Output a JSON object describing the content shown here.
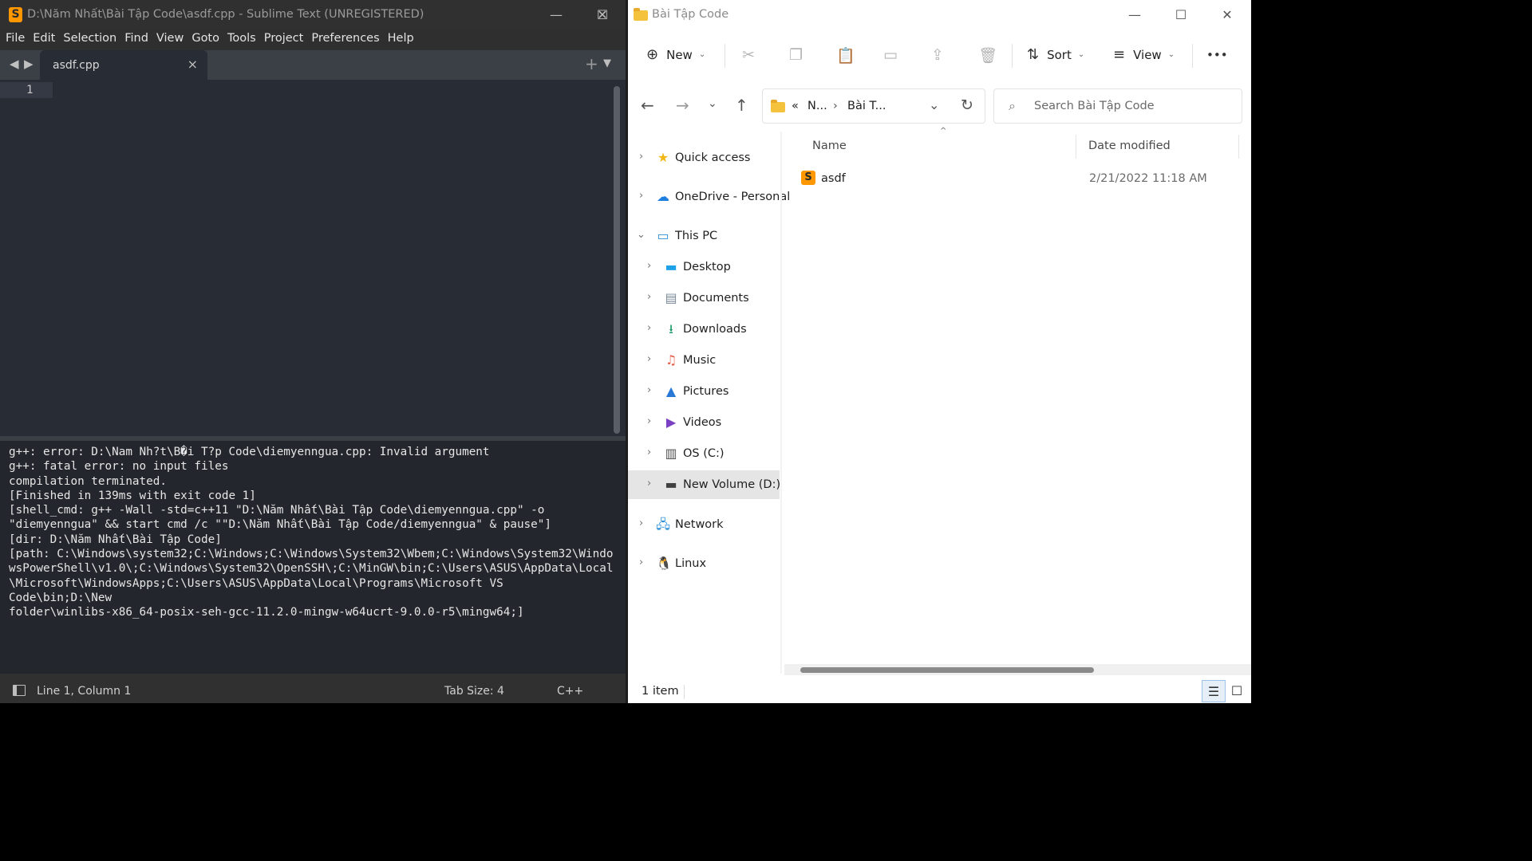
{
  "sublime": {
    "title": "D:\\Năm Nhất\\Bài Tập Code\\asdf.cpp - Sublime Text (UNREGISTERED)",
    "logo_glyph": "S",
    "window_controls": {
      "minimize": "—",
      "maximize": "☐",
      "close": "✕"
    },
    "menu": [
      "File",
      "Edit",
      "Selection",
      "Find",
      "View",
      "Goto",
      "Tools",
      "Project",
      "Preferences",
      "Help"
    ],
    "tab_nav": {
      "back": "◀",
      "forward": "▶"
    },
    "tab": {
      "label": "asdf.cpp",
      "close": "×"
    },
    "tab_actions": {
      "new_tab": "+",
      "tab_list": "▼"
    },
    "line_number": "1",
    "output": "g++: error: D:\\Nam Nh?t\\B�i T?p Code\\diemyenngua.cpp: Invalid argument\ng++: fatal error: no input files\ncompilation terminated.\n[Finished in 139ms with exit code 1]\n[shell_cmd: g++ -Wall -std=c++11 \"D:\\Năm Nhất\\Bài Tập Code\\diemyenngua.cpp\" -o\n\"diemyenngua\" && start cmd /c \"\"D:\\Năm Nhất\\Bài Tập Code/diemyenngua\" & pause\"]\n[dir: D:\\Năm Nhất\\Bài Tập Code]\n[path: C:\\Windows\\system32;C:\\Windows;C:\\Windows\\System32\\Wbem;C:\\Windows\\System32\\Windo\nwsPowerShell\\v1.0\\;C:\\Windows\\System32\\OpenSSH\\;C:\\MinGW\\bin;C:\\Users\\ASUS\\AppData\\Local\n\\Microsoft\\WindowsApps;C:\\Users\\ASUS\\AppData\\Local\\Programs\\Microsoft VS\nCode\\bin;D:\\New\nfolder\\winlibs-x86_64-posix-seh-gcc-11.2.0-mingw-w64ucrt-9.0.0-r5\\mingw64;]",
    "status": {
      "position": "Line 1, Column 1",
      "tab_size": "Tab Size: 4",
      "syntax": "C++"
    }
  },
  "explorer": {
    "title": "Bài Tập Code",
    "window_controls": {
      "minimize": "—",
      "maximize": "☐",
      "close": "✕"
    },
    "commands": {
      "new_icon": "⊕",
      "new_label": "New",
      "new_caret": "⌄",
      "cut": "✂",
      "copy": "❐",
      "paste": "📋",
      "rename": "▭",
      "share": "⇪",
      "delete": "🗑",
      "sort_icon": "⇅",
      "sort_label": "Sort",
      "sort_caret": "⌄",
      "view_icon": "≡",
      "view_label": "View",
      "view_caret": "⌄",
      "more": "•••"
    },
    "nav": {
      "back": "←",
      "forward": "→",
      "recent": "⌄",
      "up": "↑",
      "refresh": "↻"
    },
    "address": {
      "overflow": "«",
      "crumb1": "N...",
      "sep": "›",
      "crumb2": "Bài T...",
      "dropdown": "⌄"
    },
    "search": {
      "icon": "⌕",
      "placeholder": "Search Bài Tập Code"
    },
    "sidebar": [
      {
        "label": "Quick access",
        "icon": "★",
        "icon_color": "#f2b713",
        "chevron": "›"
      },
      {
        "label": "OneDrive - Personal",
        "icon": "☁",
        "icon_color": "#1f7fe0",
        "chevron": "›"
      },
      {
        "label": "This PC",
        "icon": "▭",
        "icon_color": "#2f8fd8",
        "chevron": "⌄"
      },
      {
        "label": "Desktop",
        "icon": "▬",
        "icon_color": "#1ea1e8",
        "chevron": "›"
      },
      {
        "label": "Documents",
        "icon": "▤",
        "icon_color": "#7a8a99",
        "chevron": "›"
      },
      {
        "label": "Downloads",
        "icon": "⭳",
        "icon_color": "#1a9b6b",
        "chevron": "›"
      },
      {
        "label": "Music",
        "icon": "♫",
        "icon_color": "#e35d4a",
        "chevron": "›"
      },
      {
        "label": "Pictures",
        "icon": "▲",
        "icon_color": "#2a78d6",
        "chevron": "›"
      },
      {
        "label": "Videos",
        "icon": "▶",
        "icon_color": "#7a3fc2",
        "chevron": "›"
      },
      {
        "label": "OS (C:)",
        "icon": "▥",
        "icon_color": "#505050",
        "chevron": "›"
      },
      {
        "label": "New Volume (D:)",
        "icon": "▬",
        "icon_color": "#404040",
        "chevron": "›"
      },
      {
        "label": "Network",
        "icon": "🖧",
        "icon_color": "#2f8fd8",
        "chevron": "›"
      },
      {
        "label": "Linux",
        "icon": "🐧",
        "icon_color": "#222222",
        "chevron": "›"
      }
    ],
    "selected_sidebar": "New Volume (D:)",
    "columns": {
      "name": "Name",
      "date": "Date modified",
      "sort_caret": "^"
    },
    "files": [
      {
        "name": "asdf",
        "date": "2/21/2022 11:18 AM",
        "icon_glyph": "S"
      }
    ],
    "status": {
      "count": "1 item",
      "details_icon": "☰",
      "tiles_icon": "☐"
    }
  }
}
